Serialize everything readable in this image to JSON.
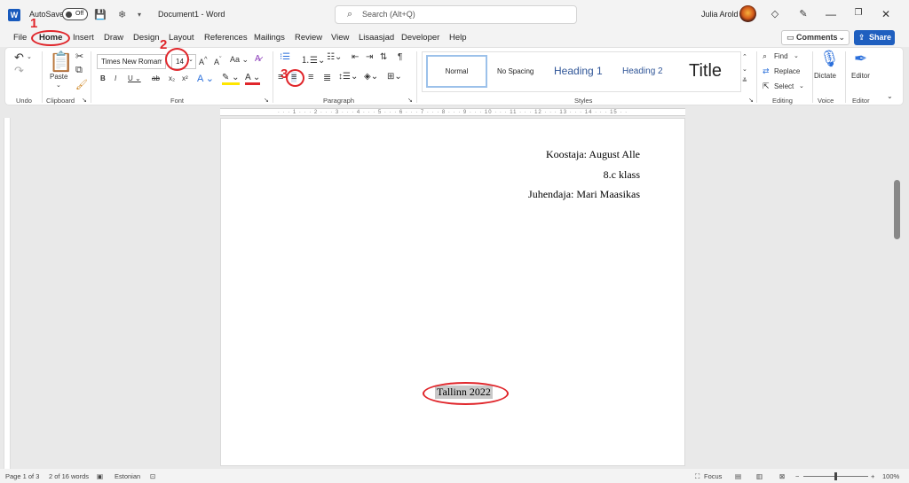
{
  "titlebar": {
    "app_icon": "W",
    "autosave_label": "AutoSave",
    "autosave_state": "Off",
    "document_title": "Document1  -  Word",
    "search_placeholder": "Search (Alt+Q)",
    "user_name": "Julia Arold"
  },
  "menu": {
    "tabs": [
      "File",
      "Home",
      "Insert",
      "Draw",
      "Design",
      "Layout",
      "References",
      "Mailings",
      "Review",
      "View",
      "Lisaasjad",
      "Developer",
      "Help"
    ],
    "active": "Home",
    "comments": "Comments",
    "share": "Share"
  },
  "ribbon": {
    "groups": {
      "undo": "Undo",
      "clipboard": "Clipboard",
      "font": "Font",
      "paragraph": "Paragraph",
      "styles": "Styles",
      "editing": "Editing",
      "voice": "Voice",
      "editor": "Editor"
    },
    "paste_label": "Paste",
    "font_name": "Times New Roman",
    "font_size": "14",
    "styles": [
      "Normal",
      "No Spacing",
      "Heading 1",
      "Heading 2",
      "Title"
    ],
    "find": "Find",
    "replace": "Replace",
    "select": "Select",
    "dictate": "Dictate",
    "editor_label": "Editor"
  },
  "document": {
    "lines_right": [
      "Koostaja: August Alle",
      "8.c klass",
      "Juhendaja: Mari Maasikas"
    ],
    "footer_center": "Tallinn 2022"
  },
  "annotations": {
    "num1": "1",
    "num2": "2",
    "num3": "3",
    "color": "#e0262b"
  },
  "statusbar": {
    "page": "Page 1 of 3",
    "words": "2 of 16 words",
    "language": "Estonian",
    "focus": "Focus",
    "zoom": "100%"
  },
  "colors": {
    "accent": "#185abd",
    "share": "#1f5fbf",
    "highlight": "#c8c8c8"
  }
}
